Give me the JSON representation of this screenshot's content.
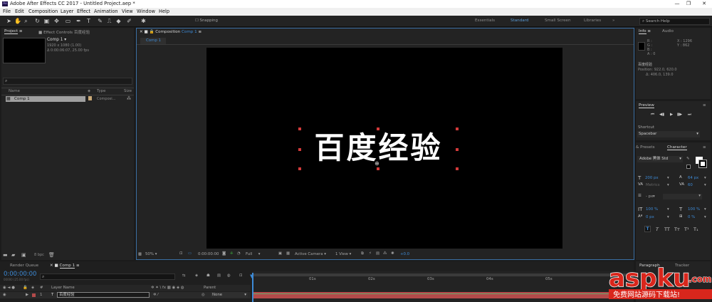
{
  "window": {
    "title": "Adobe After Effects CC 2017 - Untitled Project.aep *",
    "logo": "Ae"
  },
  "menu": [
    "File",
    "Edit",
    "Composition",
    "Layer",
    "Effect",
    "Animation",
    "View",
    "Window",
    "Help"
  ],
  "toolbar": {
    "snapping_label": "Snapping",
    "workspaces": [
      "Essentials",
      "Standard",
      "Small Screen",
      "Libraries"
    ],
    "active_workspace": "Standard",
    "search_placeholder": "Search Help"
  },
  "project_panel": {
    "tab_project": "Project",
    "tab_effect_controls": "Effect Controls 百度经验",
    "item_name": "Comp 1 ▾",
    "item_res": "1920 x 1080 (1.00)",
    "item_dur": "Δ 0:00:06:07, 25.00 fps",
    "columns": {
      "name": "Name",
      "type": "Type",
      "size": "Size"
    },
    "rows": [
      {
        "name": "Comp 1",
        "type": "Composi..."
      }
    ],
    "bpc": "8 bpc"
  },
  "composition_panel": {
    "tab_label": "Composition",
    "comp_name": "Comp 1",
    "subtab": "Comp 1",
    "text_layer": "百度经验",
    "footer": {
      "zoom": "50%",
      "timecode": "0:00:00:00",
      "resolution": "Full",
      "camera": "Active Camera",
      "view": "1 View",
      "exposure": "+0.0"
    }
  },
  "info_panel": {
    "tab_info": "Info",
    "tab_audio": "Audio",
    "rgb_labels": [
      "R :",
      "G :",
      "B :",
      "A : 0"
    ],
    "x_label": "X : 1296",
    "y_label": "Y : 862",
    "layer_name": "百度经验",
    "position": "Position: 922.0, 620.0",
    "delta": "Δ: 406.0, 139.0"
  },
  "preview_panel": {
    "tab_label": "Preview",
    "shortcut_label": "Shortcut",
    "shortcut_value": "Spacebar"
  },
  "character_panel": {
    "tab_presets": "& Presets",
    "tab_character": "Character",
    "font": "Adobe 黑体 Std",
    "font_size": "200 px",
    "leading": "64 px",
    "tracking_label": "Metrics",
    "tracking_value": "60",
    "stroke_unit": "- px",
    "vert_scale": "100 %",
    "horiz_scale": "100 %",
    "baseline": "0 px",
    "tsume": "0 %",
    "styles": [
      "T",
      "T",
      "TT",
      "Tт",
      "T¹",
      "T₁"
    ]
  },
  "timeline": {
    "tab_render": "Render Queue",
    "tab_comp": "Comp 1",
    "timecode": "0:00:00:00",
    "timecode_sub": "00000 (25.00 fps)",
    "header_layer": "Layer Name",
    "header_parent": "Parent",
    "layer_number": "1",
    "layer_type": "T",
    "layer_name": "百度经验",
    "parent_value": "None",
    "ruler": [
      "01s",
      "02s",
      "03s",
      "04s",
      "05s"
    ],
    "right_tabs": [
      "Paragraph",
      "Tracker"
    ]
  },
  "watermark": {
    "brand": "aspku",
    "suffix": ".com",
    "caption": "免费网站源码下载站!"
  },
  "colors": {
    "accent": "#3d8ad6",
    "selection": "#d23a3a",
    "layer_bar": "#b34a4a",
    "watermark_red": "#d9261c"
  }
}
